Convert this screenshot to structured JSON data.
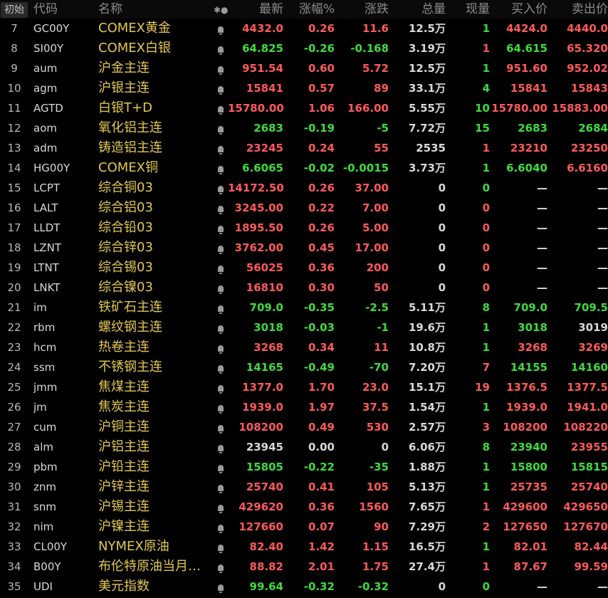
{
  "header": {
    "first_label": "初始",
    "code": "代码",
    "name": "名称",
    "icon": "✱●",
    "latest": "最新",
    "pct": "涨幅%",
    "chg": "涨跌",
    "vol": "总量",
    "cur": "现量",
    "bid": "买入价",
    "ask": "卖出价"
  },
  "colors": {
    "red": "#ff5a5a",
    "green": "#3ddc3d",
    "white": "#d8d8d8",
    "gold": "#e2c850"
  },
  "rows": [
    {
      "no": "7",
      "code": "GC00Y",
      "name": "COMEX黄金",
      "last": "4432.0",
      "pct": "0.26",
      "chg": "11.6",
      "vol": "12.5万",
      "cur": "1",
      "bid": "4424.0",
      "ask": "4440.0",
      "lc": "red",
      "pc": "red",
      "cc": "red",
      "curc": "green",
      "bc": "red",
      "ac": "red"
    },
    {
      "no": "8",
      "code": "SI00Y",
      "name": "COMEX白银",
      "last": "64.825",
      "pct": "-0.26",
      "chg": "-0.168",
      "vol": "3.19万",
      "cur": "1",
      "bid": "64.615",
      "ask": "65.320",
      "lc": "green",
      "pc": "green",
      "cc": "green",
      "curc": "red",
      "bc": "green",
      "ac": "red"
    },
    {
      "no": "9",
      "code": "aum",
      "name": "沪金主连",
      "last": "951.54",
      "pct": "0.60",
      "chg": "5.72",
      "vol": "12.5万",
      "cur": "1",
      "bid": "951.60",
      "ask": "952.02",
      "lc": "red",
      "pc": "red",
      "cc": "red",
      "curc": "green",
      "bc": "red",
      "ac": "red"
    },
    {
      "no": "10",
      "code": "agm",
      "name": "沪银主连",
      "last": "15841",
      "pct": "0.57",
      "chg": "89",
      "vol": "33.1万",
      "cur": "4",
      "bid": "15841",
      "ask": "15843",
      "lc": "red",
      "pc": "red",
      "cc": "red",
      "curc": "green",
      "bc": "red",
      "ac": "red"
    },
    {
      "no": "11",
      "code": "AGTD",
      "name": "白银T+D",
      "last": "15780.00",
      "pct": "1.06",
      "chg": "166.00",
      "vol": "5.55万",
      "cur": "10",
      "bid": "15780.00",
      "ask": "15883.00",
      "lc": "red",
      "pc": "red",
      "cc": "red",
      "curc": "green",
      "bc": "red",
      "ac": "red"
    },
    {
      "no": "12",
      "code": "aom",
      "name": "氧化铝主连",
      "last": "2683",
      "pct": "-0.19",
      "chg": "-5",
      "vol": "7.72万",
      "cur": "15",
      "bid": "2683",
      "ask": "2684",
      "lc": "green",
      "pc": "green",
      "cc": "green",
      "curc": "green",
      "bc": "green",
      "ac": "green"
    },
    {
      "no": "13",
      "code": "adm",
      "name": "铸造铝主连",
      "last": "23245",
      "pct": "0.24",
      "chg": "55",
      "vol": "2535",
      "cur": "1",
      "bid": "23210",
      "ask": "23250",
      "lc": "red",
      "pc": "red",
      "cc": "red",
      "curc": "red",
      "bc": "red",
      "ac": "red"
    },
    {
      "no": "14",
      "code": "HG00Y",
      "name": "COMEX铜",
      "last": "6.6065",
      "pct": "-0.02",
      "chg": "-0.0015",
      "vol": "3.73万",
      "cur": "1",
      "bid": "6.6040",
      "ask": "6.6160",
      "lc": "green",
      "pc": "green",
      "cc": "green",
      "curc": "green",
      "bc": "green",
      "ac": "red"
    },
    {
      "no": "15",
      "code": "LCPT",
      "name": "综合铜03",
      "last": "14172.50",
      "pct": "0.26",
      "chg": "37.00",
      "vol": "0",
      "cur": "0",
      "bid": "—",
      "ask": "—",
      "lc": "red",
      "pc": "red",
      "cc": "red",
      "curc": "green",
      "bc": "white",
      "ac": "white"
    },
    {
      "no": "16",
      "code": "LALT",
      "name": "综合铝03",
      "last": "3245.00",
      "pct": "0.22",
      "chg": "7.00",
      "vol": "0",
      "cur": "0",
      "bid": "—",
      "ask": "—",
      "lc": "red",
      "pc": "red",
      "cc": "red",
      "curc": "red",
      "bc": "white",
      "ac": "white"
    },
    {
      "no": "17",
      "code": "LLDT",
      "name": "综合铅03",
      "last": "1895.50",
      "pct": "0.26",
      "chg": "5.00",
      "vol": "0",
      "cur": "0",
      "bid": "—",
      "ask": "—",
      "lc": "red",
      "pc": "red",
      "cc": "red",
      "curc": "red",
      "bc": "white",
      "ac": "white"
    },
    {
      "no": "18",
      "code": "LZNT",
      "name": "综合锌03",
      "last": "3762.00",
      "pct": "0.45",
      "chg": "17.00",
      "vol": "0",
      "cur": "0",
      "bid": "—",
      "ask": "—",
      "lc": "red",
      "pc": "red",
      "cc": "red",
      "curc": "red",
      "bc": "white",
      "ac": "white"
    },
    {
      "no": "19",
      "code": "LTNT",
      "name": "综合锡03",
      "last": "56025",
      "pct": "0.36",
      "chg": "200",
      "vol": "0",
      "cur": "0",
      "bid": "—",
      "ask": "—",
      "lc": "red",
      "pc": "red",
      "cc": "red",
      "curc": "red",
      "bc": "white",
      "ac": "white"
    },
    {
      "no": "20",
      "code": "LNKT",
      "name": "综合镍03",
      "last": "16810",
      "pct": "0.30",
      "chg": "50",
      "vol": "0",
      "cur": "0",
      "bid": "—",
      "ask": "—",
      "lc": "red",
      "pc": "red",
      "cc": "red",
      "curc": "red",
      "bc": "white",
      "ac": "white"
    },
    {
      "no": "21",
      "code": "im",
      "name": "铁矿石主连",
      "last": "709.0",
      "pct": "-0.35",
      "chg": "-2.5",
      "vol": "5.11万",
      "cur": "8",
      "bid": "709.0",
      "ask": "709.5",
      "lc": "green",
      "pc": "green",
      "cc": "green",
      "curc": "green",
      "bc": "green",
      "ac": "green"
    },
    {
      "no": "22",
      "code": "rbm",
      "name": "螺纹钢主连",
      "last": "3018",
      "pct": "-0.03",
      "chg": "-1",
      "vol": "19.6万",
      "cur": "1",
      "bid": "3018",
      "ask": "3019",
      "lc": "green",
      "pc": "green",
      "cc": "green",
      "curc": "green",
      "bc": "green",
      "ac": "white"
    },
    {
      "no": "23",
      "code": "hcm",
      "name": "热卷主连",
      "last": "3268",
      "pct": "0.34",
      "chg": "11",
      "vol": "10.8万",
      "cur": "1",
      "bid": "3268",
      "ask": "3269",
      "lc": "red",
      "pc": "red",
      "cc": "red",
      "curc": "green",
      "bc": "red",
      "ac": "red"
    },
    {
      "no": "24",
      "code": "ssm",
      "name": "不锈钢主连",
      "last": "14165",
      "pct": "-0.49",
      "chg": "-70",
      "vol": "7.20万",
      "cur": "7",
      "bid": "14155",
      "ask": "14160",
      "lc": "green",
      "pc": "green",
      "cc": "green",
      "curc": "red",
      "bc": "green",
      "ac": "green"
    },
    {
      "no": "25",
      "code": "jmm",
      "name": "焦煤主连",
      "last": "1377.0",
      "pct": "1.70",
      "chg": "23.0",
      "vol": "15.1万",
      "cur": "19",
      "bid": "1376.5",
      "ask": "1377.5",
      "lc": "red",
      "pc": "red",
      "cc": "red",
      "curc": "red",
      "bc": "red",
      "ac": "red"
    },
    {
      "no": "26",
      "code": "jm",
      "name": "焦炭主连",
      "last": "1939.0",
      "pct": "1.97",
      "chg": "37.5",
      "vol": "1.54万",
      "cur": "1",
      "bid": "1939.0",
      "ask": "1941.0",
      "lc": "red",
      "pc": "red",
      "cc": "red",
      "curc": "green",
      "bc": "red",
      "ac": "red"
    },
    {
      "no": "27",
      "code": "cum",
      "name": "沪铜主连",
      "last": "108200",
      "pct": "0.49",
      "chg": "530",
      "vol": "2.57万",
      "cur": "3",
      "bid": "108200",
      "ask": "108220",
      "lc": "red",
      "pc": "red",
      "cc": "red",
      "curc": "red",
      "bc": "red",
      "ac": "red"
    },
    {
      "no": "28",
      "code": "alm",
      "name": "沪铝主连",
      "last": "23945",
      "pct": "0.00",
      "chg": "0",
      "vol": "6.06万",
      "cur": "8",
      "bid": "23940",
      "ask": "23955",
      "lc": "white",
      "pc": "white",
      "cc": "white",
      "curc": "green",
      "bc": "green",
      "ac": "red"
    },
    {
      "no": "29",
      "code": "pbm",
      "name": "沪铅主连",
      "last": "15805",
      "pct": "-0.22",
      "chg": "-35",
      "vol": "1.88万",
      "cur": "1",
      "bid": "15800",
      "ask": "15815",
      "lc": "green",
      "pc": "green",
      "cc": "green",
      "curc": "green",
      "bc": "green",
      "ac": "green"
    },
    {
      "no": "30",
      "code": "znm",
      "name": "沪锌主连",
      "last": "25740",
      "pct": "0.41",
      "chg": "105",
      "vol": "5.13万",
      "cur": "1",
      "bid": "25735",
      "ask": "25740",
      "lc": "red",
      "pc": "red",
      "cc": "red",
      "curc": "green",
      "bc": "red",
      "ac": "red"
    },
    {
      "no": "31",
      "code": "snm",
      "name": "沪锡主连",
      "last": "429620",
      "pct": "0.36",
      "chg": "1560",
      "vol": "7.65万",
      "cur": "1",
      "bid": "429600",
      "ask": "429650",
      "lc": "red",
      "pc": "red",
      "cc": "red",
      "curc": "red",
      "bc": "red",
      "ac": "red"
    },
    {
      "no": "32",
      "code": "nim",
      "name": "沪镍主连",
      "last": "127660",
      "pct": "0.07",
      "chg": "90",
      "vol": "7.29万",
      "cur": "2",
      "bid": "127650",
      "ask": "127670",
      "lc": "red",
      "pc": "red",
      "cc": "red",
      "curc": "red",
      "bc": "red",
      "ac": "red"
    },
    {
      "no": "33",
      "code": "CL00Y",
      "name": "NYMEX原油",
      "last": "82.40",
      "pct": "1.42",
      "chg": "1.15",
      "vol": "16.5万",
      "cur": "1",
      "bid": "82.01",
      "ask": "82.44",
      "lc": "red",
      "pc": "red",
      "cc": "red",
      "curc": "green",
      "bc": "red",
      "ac": "red"
    },
    {
      "no": "34",
      "code": "B00Y",
      "name": "布伦特原油当月…",
      "last": "88.82",
      "pct": "2.01",
      "chg": "1.75",
      "vol": "27.4万",
      "cur": "1",
      "bid": "87.67",
      "ask": "99.59",
      "lc": "red",
      "pc": "red",
      "cc": "red",
      "curc": "red",
      "bc": "red",
      "ac": "red"
    },
    {
      "no": "35",
      "code": "UDI",
      "name": "美元指数",
      "last": "99.64",
      "pct": "-0.32",
      "chg": "-0.32",
      "vol": "0",
      "cur": "0",
      "bid": "—",
      "ask": "—",
      "lc": "green",
      "pc": "green",
      "cc": "green",
      "curc": "green",
      "bc": "white",
      "ac": "white"
    }
  ]
}
